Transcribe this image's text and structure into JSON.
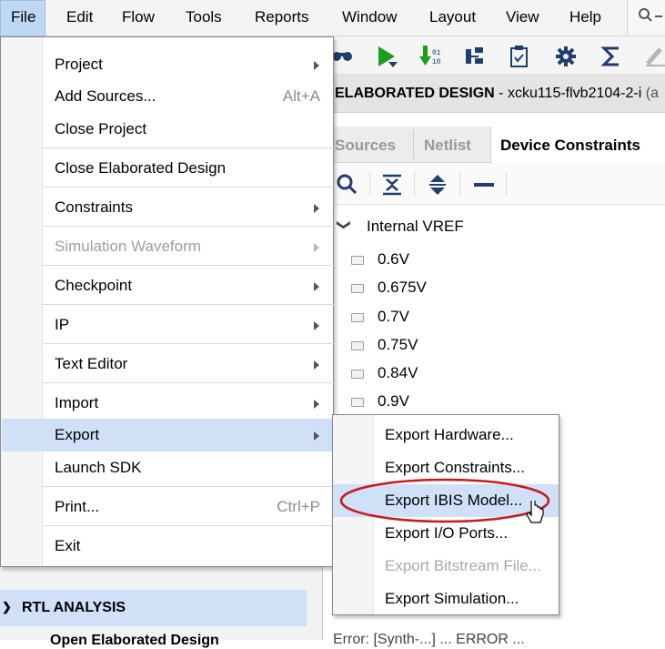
{
  "menubar": {
    "items": [
      "File",
      "Edit",
      "Flow",
      "Tools",
      "Reports",
      "Window",
      "Layout",
      "View",
      "Help"
    ],
    "search_icon": "search-icon"
  },
  "toolbar": {
    "icons": [
      "binoculars-icon",
      "run-icon",
      "bitstream-icon",
      "implementation-icon",
      "clipboard-icon",
      "gear-icon",
      "sigma-icon",
      "edit-icon"
    ]
  },
  "design_header": {
    "title_bold": "ELABORATED DESIGN",
    "title_rest": " - xcku115-flvb2104-2-i",
    "title_tail": "(a"
  },
  "tabs": {
    "sources": "Sources",
    "netlist": "Netlist",
    "device_constraints": "Device Constraints"
  },
  "tree": {
    "root": "Internal VREF",
    "items": [
      "0.6V",
      "0.675V",
      "0.7V",
      "0.75V",
      "0.84V",
      "0.9V"
    ]
  },
  "left_panel": {
    "section": "RTL ANALYSIS",
    "item": "Open Elaborated Design"
  },
  "status_line": "Error: [Synth-...] ... ERROR ...",
  "file_menu": {
    "project": "Project",
    "add_sources": "Add Sources...",
    "add_sources_accel": "Alt+A",
    "close_project": "Close Project",
    "close_elaborated": "Close Elaborated Design",
    "constraints": "Constraints",
    "simulation_waveform": "Simulation Waveform",
    "checkpoint": "Checkpoint",
    "ip": "IP",
    "text_editor": "Text Editor",
    "import": "Import",
    "export": "Export",
    "launch_sdk": "Launch SDK",
    "print": "Print...",
    "print_accel": "Ctrl+P",
    "exit": "Exit"
  },
  "export_menu": {
    "hardware": "Export Hardware...",
    "constraints": "Export Constraints...",
    "ibis": "Export IBIS Model...",
    "io_ports": "Export I/O Ports...",
    "bitstream": "Export Bitstream File...",
    "simulation": "Export Simulation..."
  },
  "colors": {
    "highlight": "#cfe0f7",
    "annotation": "#c8191e",
    "disabled": "#9e9e9e"
  }
}
